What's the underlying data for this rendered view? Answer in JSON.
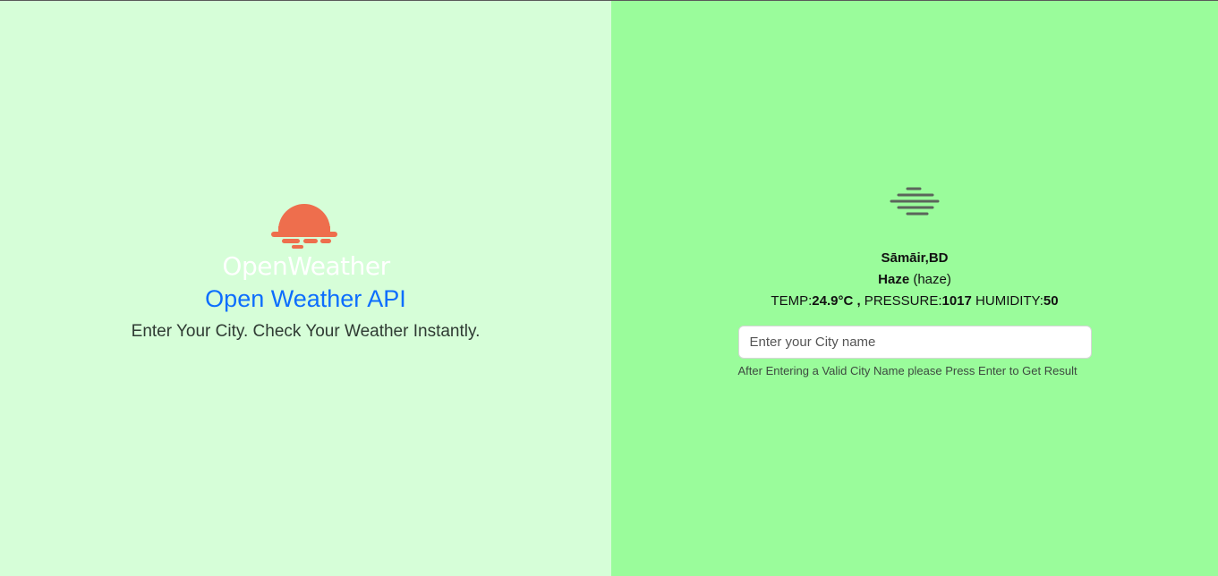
{
  "brand": {
    "logo_text": "OpenWeather",
    "title": "Open Weather API",
    "tagline": "Enter Your City. Check Your Weather Instantly.",
    "colors": {
      "sun": "#ee6e4d",
      "logo_text": "#ffffff",
      "title": "#0d6efd"
    },
    "logo_icon": "sun-logo-icon"
  },
  "weather": {
    "icon": "haze-icon",
    "location": "Sāmāir,BD",
    "condition_main": "Haze",
    "condition_desc": " (haze)",
    "temp_label": "TEMP:",
    "temp_value": "24.9°C ,",
    "pressure_label": " PRESSURE:",
    "pressure_value": "1017",
    "humidity_label": " HUMIDITY:",
    "humidity_value": "50"
  },
  "search": {
    "placeholder": "Enter your City name",
    "value": "",
    "hint": "After Entering a Valid City Name please Press Enter to Get Result"
  },
  "colors": {
    "left_background": "#d6fed8",
    "right_background": "#9afc9b"
  }
}
